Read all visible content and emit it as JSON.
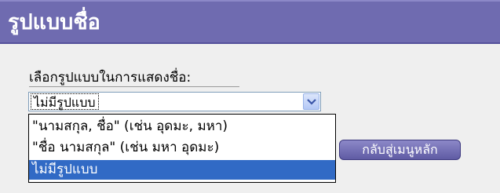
{
  "header": {
    "title": "รูปแบบชื่อ"
  },
  "form": {
    "label": "เลือกรูปแบบในการแสดงชื่อ:",
    "select": {
      "selected_value": "ไม่มีรูปแบบ",
      "options": [
        "\"นามสกุล, ชื่อ\" (เช่น อุดมะ, มหา)",
        "\"ชื่อ นามสกุล\" (เช่น มหา อุดมะ)",
        "ไม่มีรูปแบบ"
      ],
      "highlighted_index": 2
    },
    "main_menu_button": "กลับสู่เมนูหลัก"
  },
  "colors": {
    "header_bg": "#6f6bb0",
    "panel_bg": "#efefef",
    "selection": "#316ac5"
  },
  "icons": {
    "dropdown": "chevron-down-icon"
  }
}
